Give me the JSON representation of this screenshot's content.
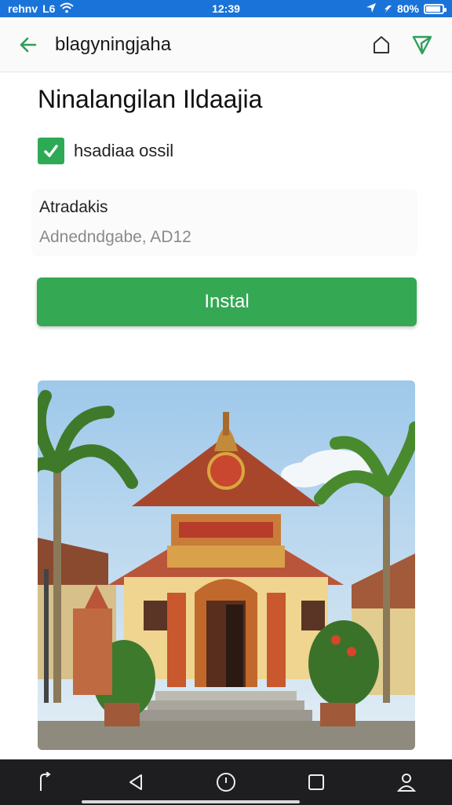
{
  "status_bar": {
    "carrier": "rehnv",
    "network": "L6",
    "time": "12:39",
    "battery": "80%",
    "icons": [
      "wifi-icon",
      "location-icon",
      "signal-icon",
      "battery-icon"
    ]
  },
  "app_bar": {
    "title": "blagyningjaha",
    "icons": [
      "back-arrow-icon",
      "bookmark-icon",
      "send-icon"
    ]
  },
  "main": {
    "heading": "Ninalangilan Ildaajia",
    "checkbox": {
      "checked": true,
      "label": "hsadiaa ossil"
    },
    "field": {
      "label": "Atradakis",
      "value": "Adnedndgabe, AD12"
    },
    "install_label": "Instal"
  },
  "photo": {
    "subject": "temple-photo"
  },
  "nav_bar": {
    "icons": [
      "share-icon",
      "back-icon",
      "home-icon",
      "recents-icon",
      "profile-icon"
    ]
  },
  "colors": {
    "status_bar": "#1a73d9",
    "accent": "#34a853",
    "nav_bar": "#1e1e20"
  }
}
